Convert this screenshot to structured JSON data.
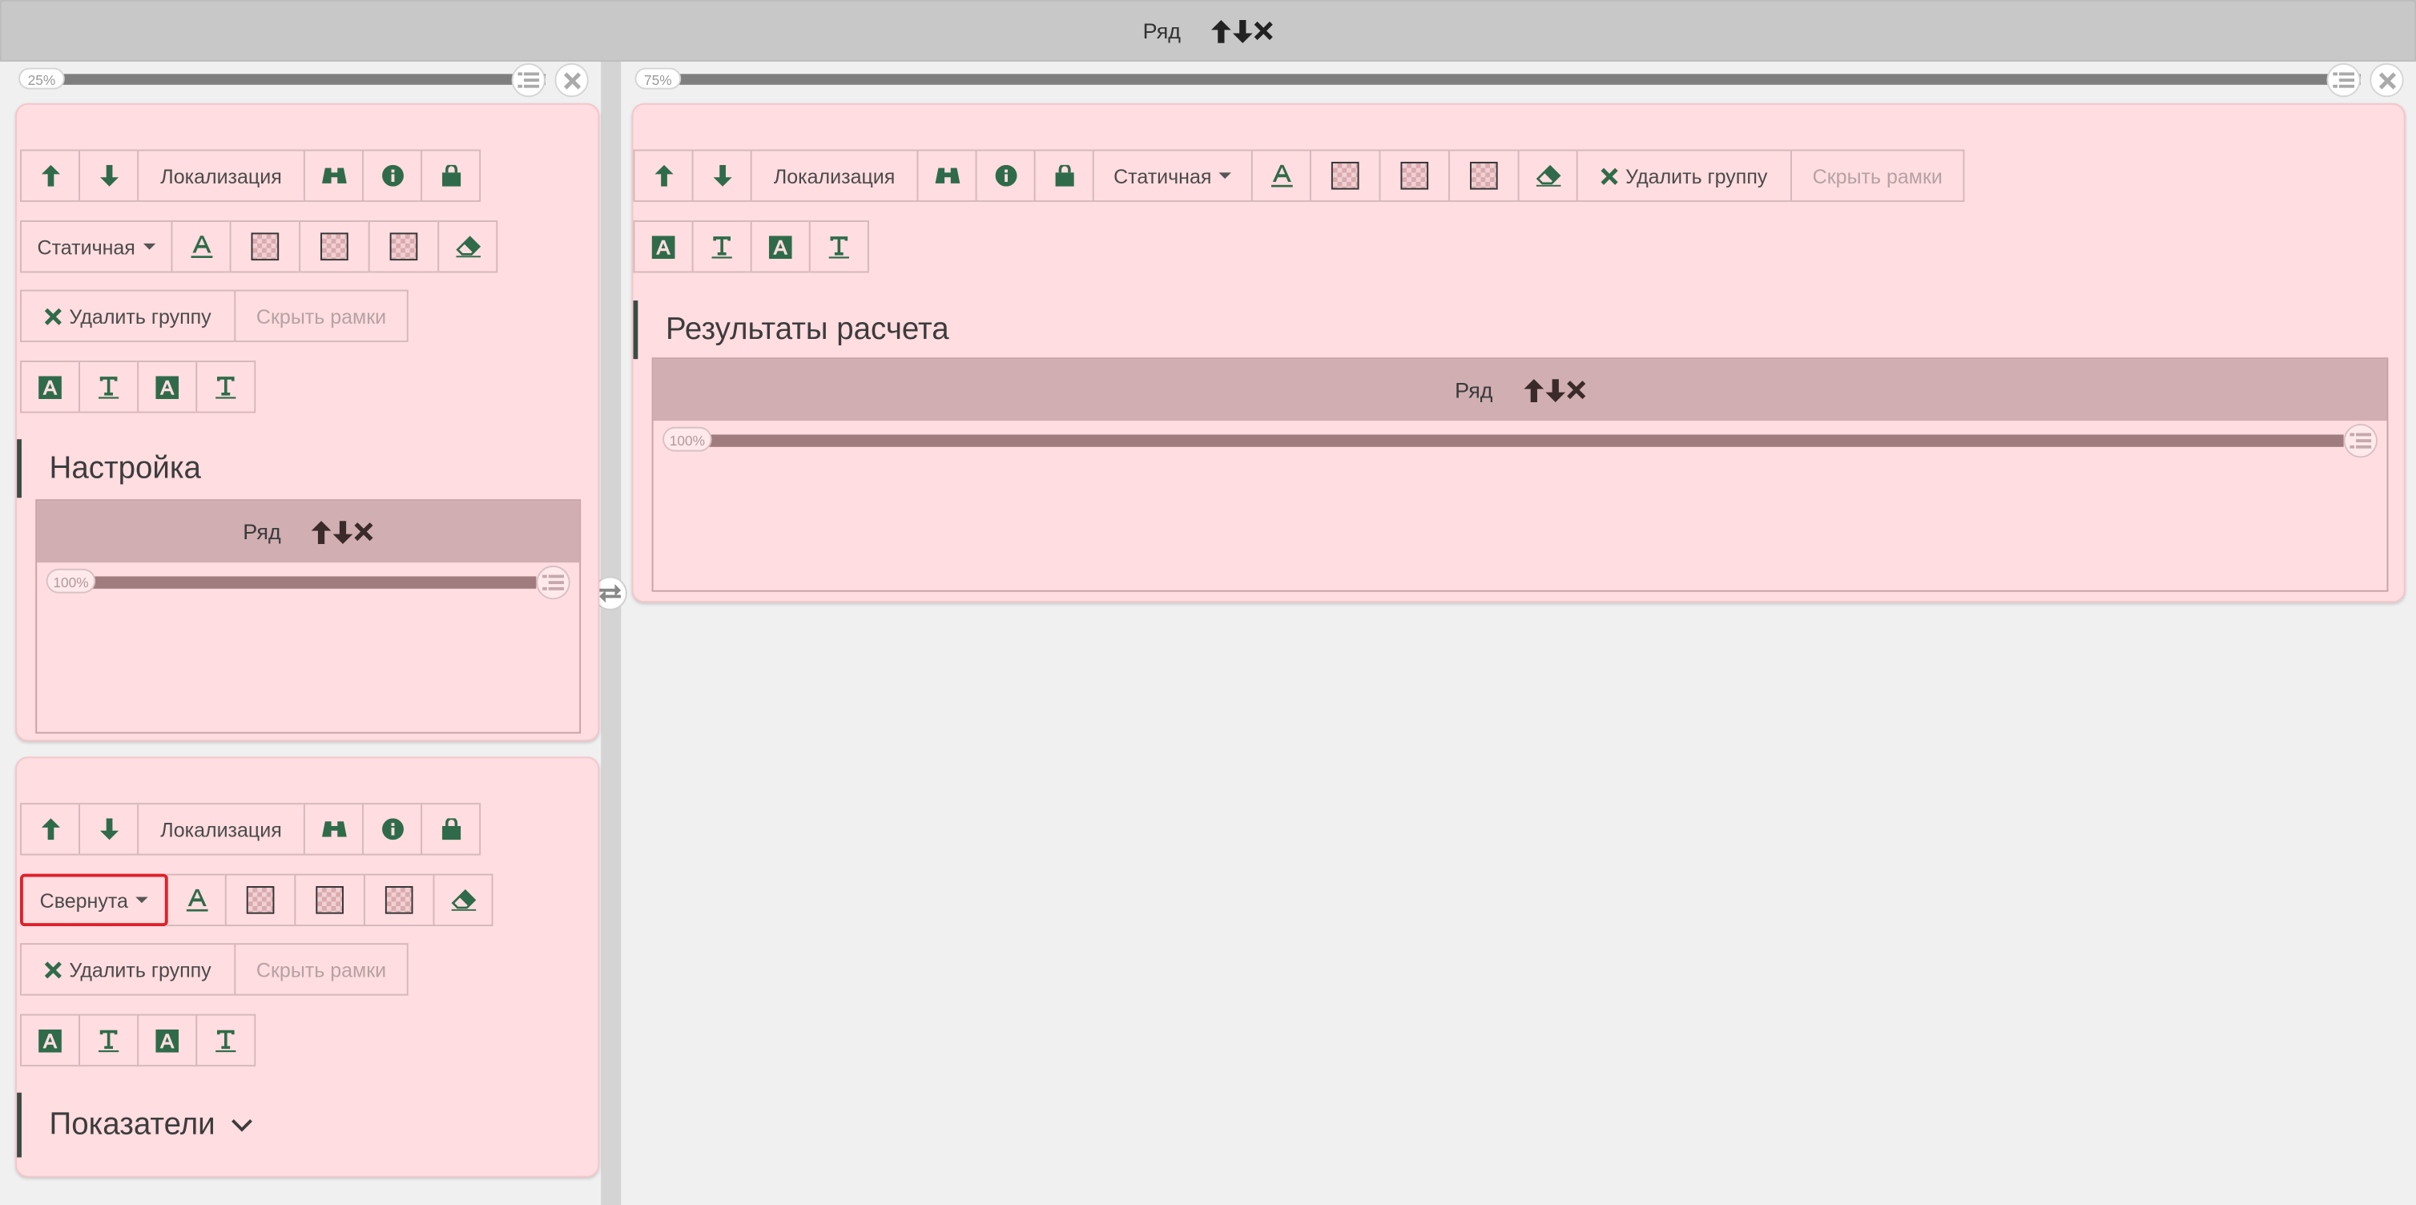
{
  "top_row": {
    "label": "Ряд"
  },
  "left_column": {
    "width_label": "25%",
    "panel1": {
      "toolbar1": {
        "localization": "Локализация"
      },
      "mode": "Статичная",
      "delete_group": "Удалить группу",
      "hide_frames": "Скрыть рамки",
      "heading": "Настройка",
      "inner_row": {
        "label": "Ряд",
        "width_label": "100%"
      }
    },
    "panel2": {
      "toolbar1": {
        "localization": "Локализация"
      },
      "mode": "Свернута",
      "delete_group": "Удалить группу",
      "hide_frames": "Скрыть рамки",
      "heading": "Показатели"
    }
  },
  "right_column": {
    "width_label": "75%",
    "panel": {
      "toolbar1": {
        "localization": "Локализация",
        "mode": "Статичная",
        "delete_group": "Удалить группу",
        "hide_frames": "Скрыть рамки"
      },
      "heading": "Результаты расчета",
      "inner_row": {
        "label": "Ряд",
        "width_label": "100%"
      }
    }
  },
  "colors": {
    "accent_green": "#2f6b4a",
    "panel_pink": "#ffdde0",
    "row_bar": "#c8c8c8",
    "inner_row_bar": "#d0aeb1",
    "highlight_red": "#e0202a"
  }
}
